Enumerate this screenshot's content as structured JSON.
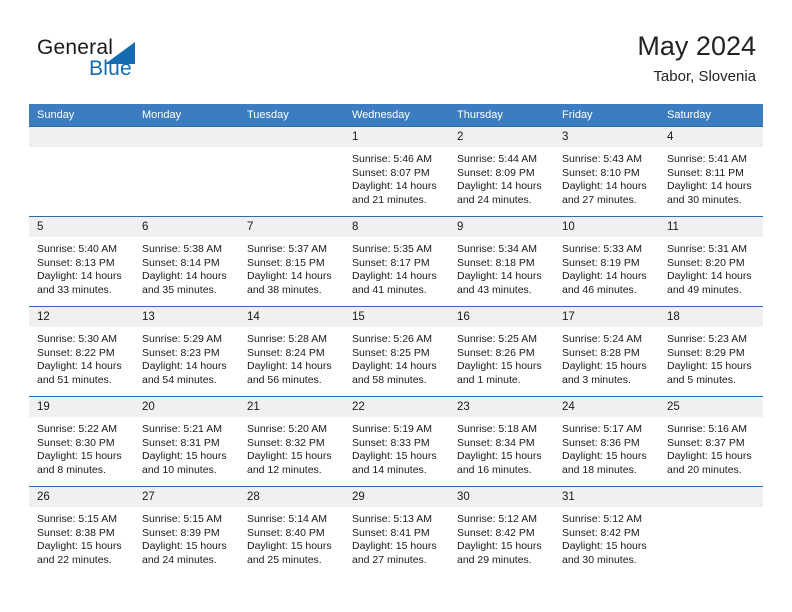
{
  "brand": {
    "name_part1": "General",
    "name_part2": "Blue",
    "logo_icon": "triangle-icon",
    "colors": {
      "accent": "#156bb1",
      "header": "#3b7dc0",
      "daynum_bg": "#f0f0f0"
    }
  },
  "header": {
    "title": "May 2024",
    "subtitle": "Tabor, Slovenia"
  },
  "calendar": {
    "weekday_headers": [
      "Sunday",
      "Monday",
      "Tuesday",
      "Wednesday",
      "Thursday",
      "Friday",
      "Saturday"
    ],
    "weeks": [
      [
        {
          "day": "",
          "empty": true
        },
        {
          "day": "",
          "empty": true
        },
        {
          "day": "",
          "empty": true
        },
        {
          "day": "1",
          "sunrise": "Sunrise: 5:46 AM",
          "sunset": "Sunset: 8:07 PM",
          "daylight1": "Daylight: 14 hours",
          "daylight2": "and 21 minutes."
        },
        {
          "day": "2",
          "sunrise": "Sunrise: 5:44 AM",
          "sunset": "Sunset: 8:09 PM",
          "daylight1": "Daylight: 14 hours",
          "daylight2": "and 24 minutes."
        },
        {
          "day": "3",
          "sunrise": "Sunrise: 5:43 AM",
          "sunset": "Sunset: 8:10 PM",
          "daylight1": "Daylight: 14 hours",
          "daylight2": "and 27 minutes."
        },
        {
          "day": "4",
          "sunrise": "Sunrise: 5:41 AM",
          "sunset": "Sunset: 8:11 PM",
          "daylight1": "Daylight: 14 hours",
          "daylight2": "and 30 minutes."
        }
      ],
      [
        {
          "day": "5",
          "sunrise": "Sunrise: 5:40 AM",
          "sunset": "Sunset: 8:13 PM",
          "daylight1": "Daylight: 14 hours",
          "daylight2": "and 33 minutes."
        },
        {
          "day": "6",
          "sunrise": "Sunrise: 5:38 AM",
          "sunset": "Sunset: 8:14 PM",
          "daylight1": "Daylight: 14 hours",
          "daylight2": "and 35 minutes."
        },
        {
          "day": "7",
          "sunrise": "Sunrise: 5:37 AM",
          "sunset": "Sunset: 8:15 PM",
          "daylight1": "Daylight: 14 hours",
          "daylight2": "and 38 minutes."
        },
        {
          "day": "8",
          "sunrise": "Sunrise: 5:35 AM",
          "sunset": "Sunset: 8:17 PM",
          "daylight1": "Daylight: 14 hours",
          "daylight2": "and 41 minutes."
        },
        {
          "day": "9",
          "sunrise": "Sunrise: 5:34 AM",
          "sunset": "Sunset: 8:18 PM",
          "daylight1": "Daylight: 14 hours",
          "daylight2": "and 43 minutes."
        },
        {
          "day": "10",
          "sunrise": "Sunrise: 5:33 AM",
          "sunset": "Sunset: 8:19 PM",
          "daylight1": "Daylight: 14 hours",
          "daylight2": "and 46 minutes."
        },
        {
          "day": "11",
          "sunrise": "Sunrise: 5:31 AM",
          "sunset": "Sunset: 8:20 PM",
          "daylight1": "Daylight: 14 hours",
          "daylight2": "and 49 minutes."
        }
      ],
      [
        {
          "day": "12",
          "sunrise": "Sunrise: 5:30 AM",
          "sunset": "Sunset: 8:22 PM",
          "daylight1": "Daylight: 14 hours",
          "daylight2": "and 51 minutes."
        },
        {
          "day": "13",
          "sunrise": "Sunrise: 5:29 AM",
          "sunset": "Sunset: 8:23 PM",
          "daylight1": "Daylight: 14 hours",
          "daylight2": "and 54 minutes."
        },
        {
          "day": "14",
          "sunrise": "Sunrise: 5:28 AM",
          "sunset": "Sunset: 8:24 PM",
          "daylight1": "Daylight: 14 hours",
          "daylight2": "and 56 minutes."
        },
        {
          "day": "15",
          "sunrise": "Sunrise: 5:26 AM",
          "sunset": "Sunset: 8:25 PM",
          "daylight1": "Daylight: 14 hours",
          "daylight2": "and 58 minutes."
        },
        {
          "day": "16",
          "sunrise": "Sunrise: 5:25 AM",
          "sunset": "Sunset: 8:26 PM",
          "daylight1": "Daylight: 15 hours",
          "daylight2": "and 1 minute."
        },
        {
          "day": "17",
          "sunrise": "Sunrise: 5:24 AM",
          "sunset": "Sunset: 8:28 PM",
          "daylight1": "Daylight: 15 hours",
          "daylight2": "and 3 minutes."
        },
        {
          "day": "18",
          "sunrise": "Sunrise: 5:23 AM",
          "sunset": "Sunset: 8:29 PM",
          "daylight1": "Daylight: 15 hours",
          "daylight2": "and 5 minutes."
        }
      ],
      [
        {
          "day": "19",
          "sunrise": "Sunrise: 5:22 AM",
          "sunset": "Sunset: 8:30 PM",
          "daylight1": "Daylight: 15 hours",
          "daylight2": "and 8 minutes."
        },
        {
          "day": "20",
          "sunrise": "Sunrise: 5:21 AM",
          "sunset": "Sunset: 8:31 PM",
          "daylight1": "Daylight: 15 hours",
          "daylight2": "and 10 minutes."
        },
        {
          "day": "21",
          "sunrise": "Sunrise: 5:20 AM",
          "sunset": "Sunset: 8:32 PM",
          "daylight1": "Daylight: 15 hours",
          "daylight2": "and 12 minutes."
        },
        {
          "day": "22",
          "sunrise": "Sunrise: 5:19 AM",
          "sunset": "Sunset: 8:33 PM",
          "daylight1": "Daylight: 15 hours",
          "daylight2": "and 14 minutes."
        },
        {
          "day": "23",
          "sunrise": "Sunrise: 5:18 AM",
          "sunset": "Sunset: 8:34 PM",
          "daylight1": "Daylight: 15 hours",
          "daylight2": "and 16 minutes."
        },
        {
          "day": "24",
          "sunrise": "Sunrise: 5:17 AM",
          "sunset": "Sunset: 8:36 PM",
          "daylight1": "Daylight: 15 hours",
          "daylight2": "and 18 minutes."
        },
        {
          "day": "25",
          "sunrise": "Sunrise: 5:16 AM",
          "sunset": "Sunset: 8:37 PM",
          "daylight1": "Daylight: 15 hours",
          "daylight2": "and 20 minutes."
        }
      ],
      [
        {
          "day": "26",
          "sunrise": "Sunrise: 5:15 AM",
          "sunset": "Sunset: 8:38 PM",
          "daylight1": "Daylight: 15 hours",
          "daylight2": "and 22 minutes."
        },
        {
          "day": "27",
          "sunrise": "Sunrise: 5:15 AM",
          "sunset": "Sunset: 8:39 PM",
          "daylight1": "Daylight: 15 hours",
          "daylight2": "and 24 minutes."
        },
        {
          "day": "28",
          "sunrise": "Sunrise: 5:14 AM",
          "sunset": "Sunset: 8:40 PM",
          "daylight1": "Daylight: 15 hours",
          "daylight2": "and 25 minutes."
        },
        {
          "day": "29",
          "sunrise": "Sunrise: 5:13 AM",
          "sunset": "Sunset: 8:41 PM",
          "daylight1": "Daylight: 15 hours",
          "daylight2": "and 27 minutes."
        },
        {
          "day": "30",
          "sunrise": "Sunrise: 5:12 AM",
          "sunset": "Sunset: 8:42 PM",
          "daylight1": "Daylight: 15 hours",
          "daylight2": "and 29 minutes."
        },
        {
          "day": "31",
          "sunrise": "Sunrise: 5:12 AM",
          "sunset": "Sunset: 8:42 PM",
          "daylight1": "Daylight: 15 hours",
          "daylight2": "and 30 minutes."
        },
        {
          "day": "",
          "empty": true
        }
      ]
    ]
  }
}
